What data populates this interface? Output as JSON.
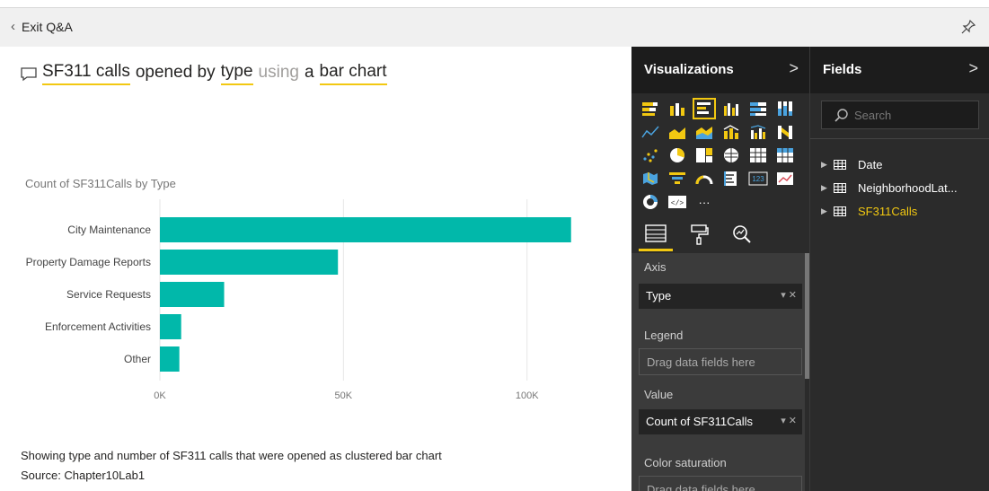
{
  "header": {
    "exit_label": "Exit Q&A",
    "icons": {
      "back": "chevron-left-icon",
      "pin": "pin-icon"
    }
  },
  "qna": {
    "icon": "speech-bubble-icon",
    "words": [
      "SF311 calls",
      "opened by",
      "type",
      "using",
      "a",
      "bar chart"
    ]
  },
  "chart_data": {
    "type": "bar",
    "orientation": "horizontal",
    "title": "Count of SF311Calls by Type",
    "categories": [
      "City Maintenance",
      "Property Damage Reports",
      "Service Requests",
      "Enforcement Activities",
      "Other"
    ],
    "values": [
      112000,
      48500,
      17500,
      5800,
      5300
    ],
    "xlim": [
      0,
      115000
    ],
    "xticks": [
      0,
      50000,
      100000
    ],
    "xtick_labels": [
      "0K",
      "50K",
      "100K"
    ],
    "grid": true,
    "color": "#01b8aa"
  },
  "footer": {
    "description": "Showing type and number of SF311 calls that were opened as clustered bar chart",
    "source": "Source: Chapter10Lab1"
  },
  "visualizations": {
    "title": "Visualizations",
    "arrow": ">",
    "icons": [
      "stacked-bar-chart-icon",
      "stacked-column-chart-icon",
      "clustered-bar-chart-icon",
      "clustered-column-chart-icon",
      "100-percent-bar-chart-icon",
      "100-percent-column-chart-icon",
      "line-chart-icon",
      "area-chart-icon",
      "stacked-area-chart-icon",
      "line-column-chart-icon",
      "line-clustered-column-chart-icon",
      "ribbon-chart-icon",
      "scatter-chart-icon",
      "pie-chart-icon",
      "treemap-icon",
      "map-icon",
      "table-icon",
      "matrix-icon",
      "filled-map-icon",
      "funnel-icon",
      "gauge-icon",
      "multi-row-card-icon",
      "card-icon",
      "kpi-icon",
      "donut-chart-icon",
      "custom-visual-icon",
      "more-icon"
    ],
    "selected_icon": "clustered-bar-chart-icon",
    "more_label": "···",
    "card_label": "123",
    "tabs": [
      "fields-tab-icon",
      "format-paint-roller-icon",
      "analytics-magnifier-icon"
    ],
    "wells": {
      "axis_label": "Axis",
      "axis_value": "Type",
      "legend_label": "Legend",
      "legend_placeholder": "Drag data fields here",
      "value_label": "Value",
      "value_value": "Count of SF311Calls",
      "color_saturation_label": "Color saturation",
      "color_saturation_placeholder": "Drag data fields here"
    }
  },
  "fields": {
    "title": "Fields",
    "arrow": ">",
    "search_placeholder": "Search",
    "tables": [
      {
        "name": "Date",
        "highlighted": false
      },
      {
        "name": "NeighborhoodLat...",
        "highlighted": false
      },
      {
        "name": "SF311Calls",
        "highlighted": true
      }
    ]
  },
  "colors": {
    "accent": "#f2c811",
    "bar": "#01b8aa",
    "pane_bg": "#2b2b2b"
  }
}
